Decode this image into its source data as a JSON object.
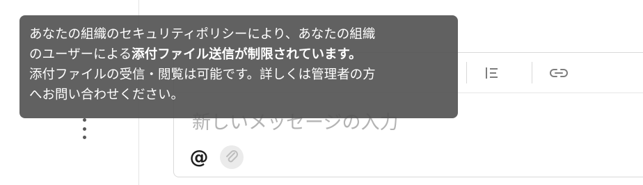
{
  "tooltip": {
    "line1": "あなたの組織のセキュリティポリシーにより、あなたの組織",
    "line2_prefix": "のユーザーによる",
    "line2_bold": "添付ファイル送信が制限されています。",
    "line3": "添付ファイルの受信・閲覧は可能です。詳しくは管理者の方",
    "line4": "へお問い合わせください。"
  },
  "composer": {
    "placeholder": "新しいメッセージの入力",
    "mention_symbol": "@"
  },
  "icons": {
    "more": "more-vertical-icon",
    "list": "list-align-icon",
    "link": "link-icon",
    "attach": "paperclip-icon",
    "mention": "at-icon"
  },
  "colors": {
    "tooltip_bg": "#505050",
    "border": "#d9d9d9",
    "placeholder": "#b3b3b3",
    "icon": "#7d7d7d"
  }
}
